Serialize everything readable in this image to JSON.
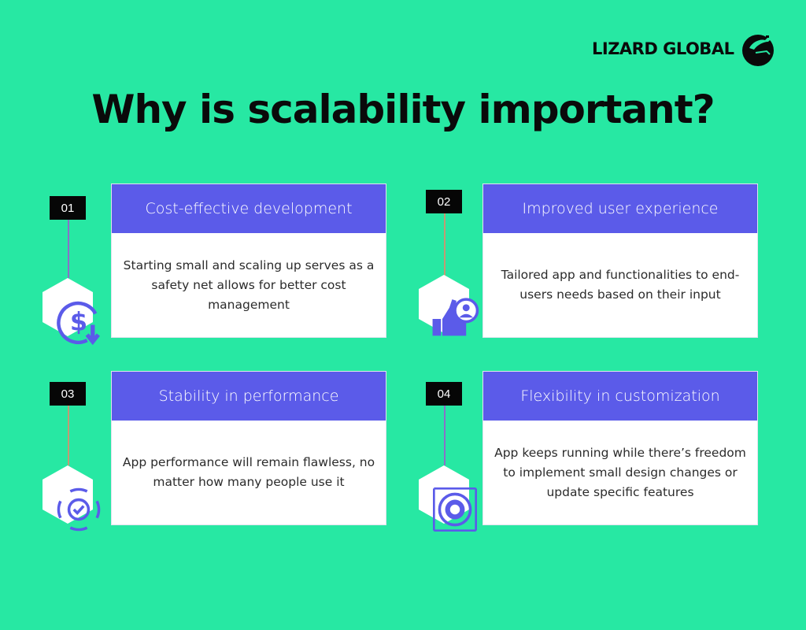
{
  "brand": {
    "name": "LIZARD GLOBAL",
    "logo_icon": "lizard-head-icon"
  },
  "title": "Why is scalability important?",
  "colors": {
    "background": "#27e8a3",
    "header": "#5b5be9",
    "badge": "#060606",
    "icon": "#5b5be9",
    "connector_purple": "#8a70c8",
    "connector_tan": "#c49a74"
  },
  "cards": [
    {
      "number": "01",
      "heading": "Cost-effective development",
      "body": "Starting small and scaling up serves as a safety net allows for better cost management",
      "icon": "dollar-cycle-icon"
    },
    {
      "number": "02",
      "heading": "Improved user experience",
      "body": "Tailored app and functionalities to end-users needs based on their input",
      "icon": "thumbs-up-user-icon"
    },
    {
      "number": "03",
      "heading": "Stability in performance",
      "body": "App performance will remain flawless, no matter how many people use it",
      "icon": "cycle-check-icon"
    },
    {
      "number": "04",
      "heading": "Flexibility in customization",
      "body": "App keeps running while there’s freedom to implement small design changes or update specific features",
      "icon": "gear-vector-icon"
    }
  ]
}
